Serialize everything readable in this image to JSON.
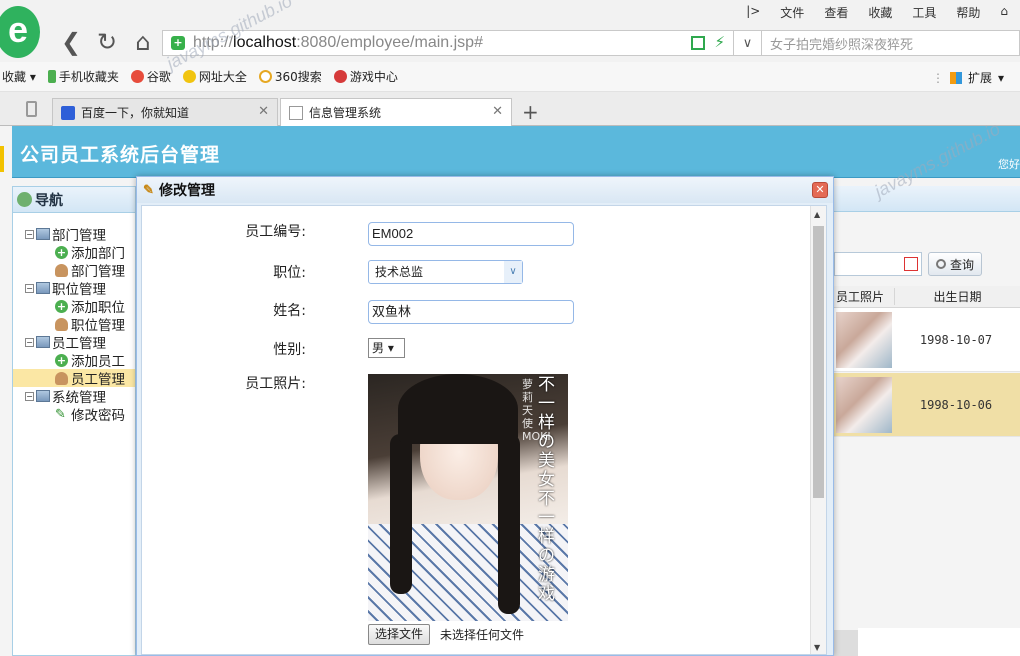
{
  "browser": {
    "menu": [
      "文件",
      "查看",
      "收藏",
      "工具",
      "帮助"
    ],
    "url_prefix": "http://",
    "url_host": "localhost",
    "url_rest": ":8080/employee/main.jsp#",
    "search_placeholder": "女子拍完婚纱照深夜猝死",
    "bookmarks": [
      "收藏",
      "手机收藏夹",
      "谷歌",
      "网址大全",
      "360搜索",
      "游戏中心"
    ],
    "extensions_label": "扩展",
    "tabs": [
      {
        "title": "百度一下，你就知道"
      },
      {
        "title": "信息管理系统"
      }
    ],
    "watermark": "javayms.github.io"
  },
  "app": {
    "title": "公司员工系统后台管理",
    "greeting": "您好",
    "nav_title": "导航",
    "tree": [
      {
        "label": "部门管理",
        "children": [
          "添加部门",
          "部门管理"
        ]
      },
      {
        "label": "职位管理",
        "children": [
          "添加职位",
          "职位管理"
        ]
      },
      {
        "label": "员工管理",
        "children": [
          "添加员工",
          "员工管理"
        ]
      },
      {
        "label": "系统管理",
        "children": [
          "修改密码"
        ]
      }
    ],
    "query_label": "查询",
    "grid_headers": [
      "员工照片",
      "出生日期"
    ],
    "grid_rows": [
      {
        "birth": "1998-10-07"
      },
      {
        "birth": "1998-10-06"
      }
    ]
  },
  "dialog": {
    "title": "修改管理",
    "fields": {
      "emp_no_label": "员工编号:",
      "emp_no_value": "EM002",
      "position_label": "职位:",
      "position_value": "技术总监",
      "name_label": "姓名:",
      "name_value": "双鱼林",
      "gender_label": "性别:",
      "gender_value": "男",
      "photo_label": "员工照片:"
    },
    "photo_overlay_main": "不一样の美女 不一样の游戏",
    "photo_overlay_side": "萝莉天使MOKI",
    "file_button": "选择文件",
    "file_status": "未选择任何文件"
  }
}
